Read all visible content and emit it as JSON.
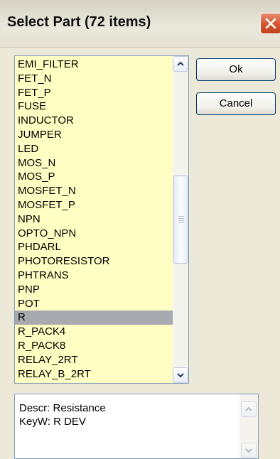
{
  "dialog": {
    "title": "Select Part (72 items)"
  },
  "list": {
    "items": [
      "EMI_FILTER",
      "FET_N",
      "FET_P",
      "FUSE",
      "INDUCTOR",
      "JUMPER",
      "LED",
      "MOS_N",
      "MOS_P",
      "MOSFET_N",
      "MOSFET_P",
      "NPN",
      "OPTO_NPN",
      "PHDARL",
      "PHOTORESISTOR",
      "PHTRANS",
      "PNP",
      "POT",
      "R",
      "R_PACK4",
      "R_PACK8",
      "RELAY_2RT",
      "RELAY_B_2RT"
    ],
    "selected": "R"
  },
  "buttons": {
    "ok_label": "Ok",
    "cancel_label": "Cancel"
  },
  "description": {
    "line1": "Descr: Resistance",
    "line2": "KeyW: R DEV"
  },
  "colors": {
    "list_background": "#ffffc4",
    "selection": "#a9a9b0",
    "close_button": "#d4542f"
  },
  "icons": {
    "close": "close-x-icon",
    "scroll_up": "chevron-up-icon",
    "scroll_down": "chevron-down-icon",
    "scroll_grip": "grip-lines-icon"
  }
}
